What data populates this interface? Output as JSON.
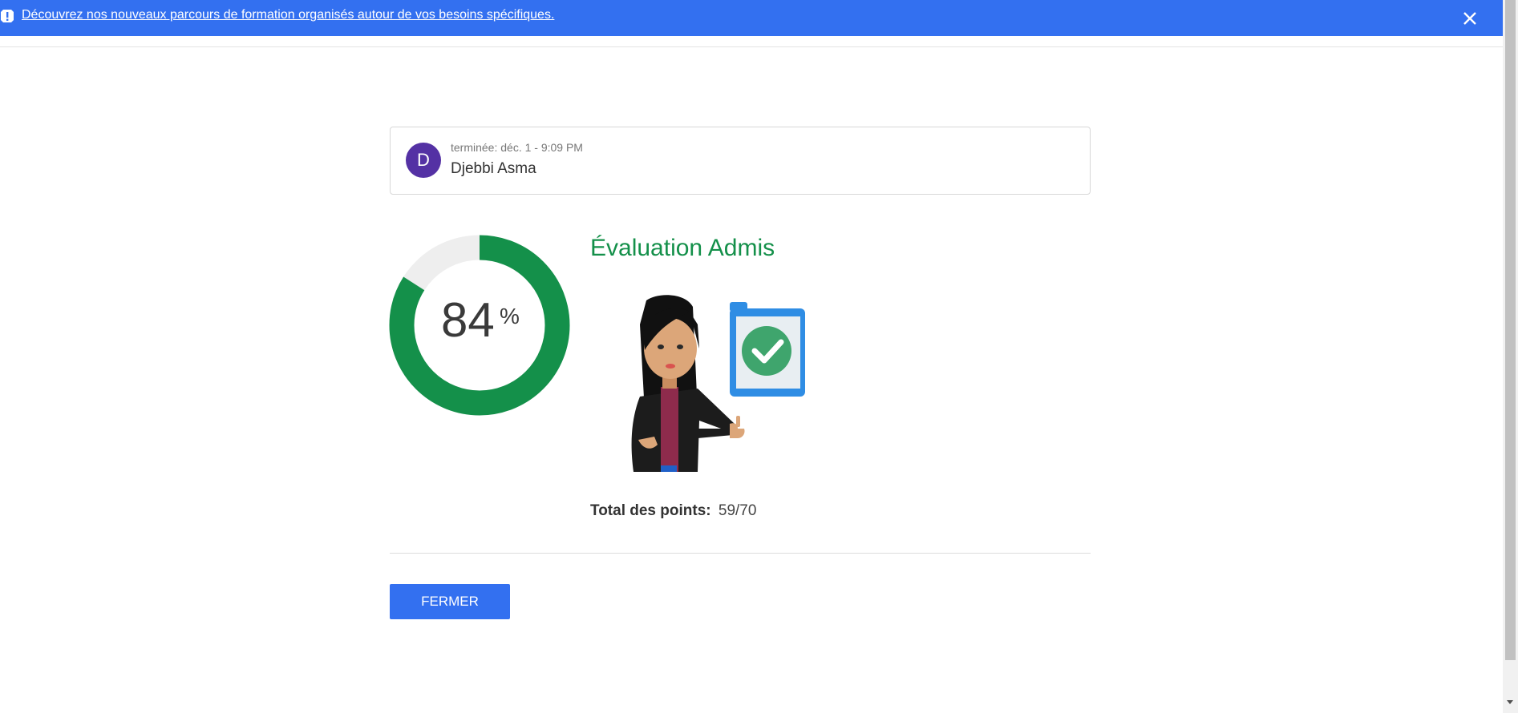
{
  "banner": {
    "message": "Découvrez nos nouveaux parcours de formation organisés autour de vos besoins spécifiques.",
    "info_icon": "exclamation-icon",
    "close_icon": "close-icon",
    "background": "#3370f0"
  },
  "submission": {
    "avatar_letter": "D",
    "avatar_color": "#5431a4",
    "completed_text": "terminée: déc. 1 - 9:09 PM",
    "name": "Djebbi Asma"
  },
  "score": {
    "percent": 84,
    "percent_text": "84",
    "unit": "%",
    "color": "#14904a",
    "track_color": "#eeeeee"
  },
  "result": {
    "title": "Évaluation Admis",
    "illustration_icon": "passed-student-illustration",
    "points_label": "Total des points:",
    "points_value": "59/70"
  },
  "actions": {
    "close_label": "FERMER"
  }
}
